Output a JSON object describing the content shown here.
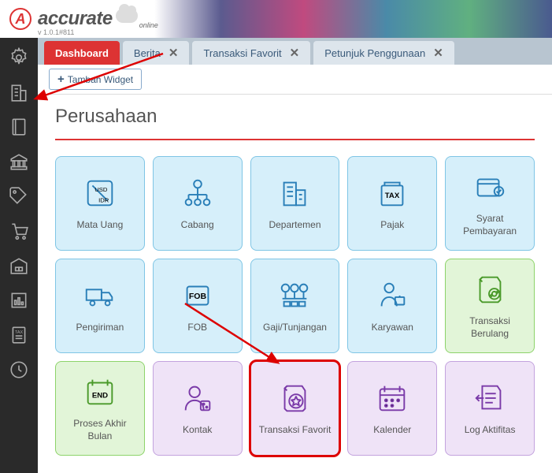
{
  "header": {
    "brand": "accurate",
    "subtext": "online",
    "version": "v 1.0.1#811"
  },
  "tabs": [
    {
      "label": "Dashboard",
      "active": true,
      "closable": false
    },
    {
      "label": "Berita",
      "active": false,
      "closable": true
    },
    {
      "label": "Transaksi Favorit",
      "active": false,
      "closable": true
    },
    {
      "label": "Petunjuk Penggunaan",
      "active": false,
      "closable": true
    }
  ],
  "toolbar": {
    "add_widget": "Tambah Widget"
  },
  "page": {
    "title": "Perusahaan"
  },
  "cards": [
    {
      "label": "Mata Uang",
      "color": "blue",
      "icon": "currency"
    },
    {
      "label": "Cabang",
      "color": "blue",
      "icon": "branch"
    },
    {
      "label": "Departemen",
      "color": "blue",
      "icon": "building"
    },
    {
      "label": "Pajak",
      "color": "blue",
      "icon": "tax"
    },
    {
      "label": "Syarat Pembayaran",
      "color": "blue",
      "icon": "wallet"
    },
    {
      "label": "Pengiriman",
      "color": "blue",
      "icon": "truck"
    },
    {
      "label": "FOB",
      "color": "blue",
      "icon": "fob"
    },
    {
      "label": "Gaji/Tunjangan",
      "color": "blue",
      "icon": "money"
    },
    {
      "label": "Karyawan",
      "color": "blue",
      "icon": "employee"
    },
    {
      "label": "Transaksi Berulang",
      "color": "green",
      "icon": "recurring"
    },
    {
      "label": "Proses Akhir Bulan",
      "color": "green",
      "icon": "monthend"
    },
    {
      "label": "Kontak",
      "color": "purple",
      "icon": "contact"
    },
    {
      "label": "Transaksi Favorit",
      "color": "purple",
      "icon": "favorite",
      "highlight": true
    },
    {
      "label": "Kalender",
      "color": "purple",
      "icon": "calendar"
    },
    {
      "label": "Log Aktifitas",
      "color": "purple",
      "icon": "log"
    }
  ]
}
